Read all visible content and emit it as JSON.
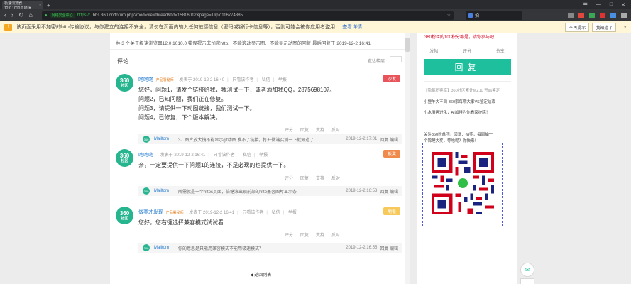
{
  "browser": {
    "tab_title": "极速浏览器12.0.1010.0 错误",
    "close_glyph": "×",
    "new_tab_glyph": "+",
    "window_controls": [
      "☰",
      "—",
      "□",
      "✕"
    ],
    "address": {
      "secure_label": "网络安全中心",
      "scheme": "https://",
      "rest": "bbs.360.cn/forum.php?mod=viewthread&tid=15816012&page=1#pid116774885"
    },
    "search_text": "拍",
    "nav": {
      "back": "‹",
      "forward": "›",
      "reload": "↻",
      "home": "⌂",
      "star": "☆"
    }
  },
  "warning": {
    "icon": "warning-icon",
    "text": "该页面采用不加密的http传输协议，与你建立的连接不安全，请勿在页面内输入任何敏感信息（密码或银行卡信息等），否则可能会被你应用者盗用",
    "link": "查看详情",
    "buttons": [
      "不再提示",
      "我知道了"
    ],
    "close": "×"
  },
  "thread": {
    "summary": "共 3 个关于极速浏览器12.0.1010.0 错误提示非加密http、不能滚动显示图、不能显示动图的回复 最后回复于 2019-12-2 16:41",
    "heading": "评论",
    "sort_label": "直达楼层",
    "pagination": "◀ 返回列表"
  },
  "posts": [
    {
      "avatar_n": "360",
      "avatar_t": "社区",
      "user": "咚咚咚",
      "tag": "产品署秘师",
      "meta": "发表于 2019-12-2 16:40",
      "meta_links": [
        "只看该作者",
        "私信",
        "举报"
      ],
      "badge": "沙发",
      "badge_color": "#e9545b",
      "lines": [
        "您好，问题1，请发个链接给我，我测试一下，或者添加我QQ，2875698107。",
        "问题2，已知问题，我们正在修复。",
        "问题3，请提供一下动图链接，我们测试一下。",
        "问题4，已修复，下个版本解决。"
      ],
      "actions": [
        "评分",
        "回复",
        "支持",
        "反对"
      ],
      "reply": {
        "name": "Mailtom",
        "text": "3、图片放大镜不能显示gif动图 发不了链接，打开微端实测一下就知道了",
        "time": "2019-12-2 17:01",
        "ops": "回复 编辑"
      }
    },
    {
      "avatar_n": "360",
      "avatar_t": "社区",
      "user": "咚咚咚",
      "tag": "",
      "meta": "发表于 2019-12-2 16:41",
      "meta_links": [
        "只看该作者",
        "私信",
        "举报"
      ],
      "badge": "板凳",
      "badge_color": "#f08a4b",
      "lines": [
        "亲，一定要提供一下问题1的连接，不是必现的也提供一下。"
      ],
      "actions": [
        "评分",
        "回复",
        "支持",
        "反对"
      ],
      "reply": {
        "name": "Mailtom",
        "text": "所需就是一个https页面，倍糖滚出现前部的http兼容图片显示条",
        "time": "2019-12-2 16:53",
        "ops": "回复 编辑"
      }
    },
    {
      "avatar_n": "360",
      "avatar_t": "社区",
      "user": "做栗才发现",
      "tag": "产品署秘师",
      "meta": "发表于 2019-12-2 16:41",
      "meta_links": [
        "只看该作者",
        "私信",
        "举报"
      ],
      "badge": "地板",
      "badge_color": "#f7c95a",
      "lines": [
        "您好，您右键选择兼容模式试试看"
      ],
      "actions": [
        "评分",
        "回复",
        "支持",
        "反对"
      ],
      "reply": {
        "name": "Mailtom",
        "text": "你的意思是只能用兼容模式不能用极速模式？",
        "time": "2019-12-2 16:55",
        "ops": "回复 编辑"
      }
    }
  ],
  "right_panel": {
    "promo": "360粉丝的100积分都是，请你参与吧！",
    "share_row": [
      "发帖",
      "评分",
      "分享"
    ],
    "reply_button": "回复",
    "lines": [
      {
        "text": "【隐藏积鉴库】360社区累计MZ10 开启鉴定",
        "gray": true
      },
      {
        "text": "小狸午大不同-360家每期大事VS鉴定结束",
        "gray": false
      },
      {
        "text": "小水清再进化，AI加持为你看家护院！",
        "gray": false
      },
      {
        "text": "关注360粉丝团，回复：抽奖，每周抽一",
        "gray": false
      },
      {
        "text": "个锦鲤大奖，等啥呢？你快来！",
        "gray": false
      }
    ]
  },
  "floating": {
    "chat_icon": "chat-icon"
  }
}
